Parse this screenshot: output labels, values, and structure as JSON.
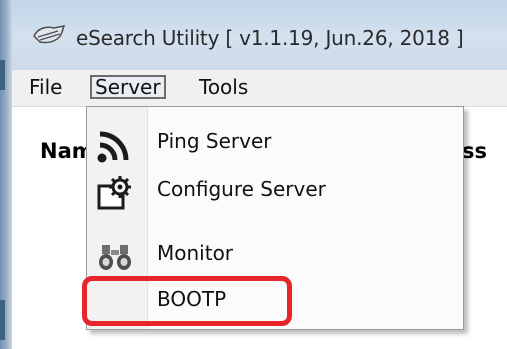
{
  "window": {
    "title": "eSearch Utility [ v1.1.19, Jun.26, 2018 ]"
  },
  "menubar": {
    "items": [
      {
        "label": "File"
      },
      {
        "label": "Server"
      },
      {
        "label": "Tools"
      }
    ],
    "open_menu": "Server"
  },
  "table": {
    "columns": [
      {
        "label": "Nam"
      },
      {
        "label": "ss"
      }
    ]
  },
  "server_menu": {
    "items": [
      {
        "label": "Ping Server",
        "icon": "signal-icon"
      },
      {
        "label": "Configure Server",
        "icon": "configure-icon"
      },
      {
        "label": "Monitor",
        "icon": "binoculars-icon"
      },
      {
        "label": "BOOTP",
        "icon": ""
      }
    ]
  },
  "annotation": {
    "highlight_color": "#e8252b",
    "highlighted_item": "BOOTP"
  }
}
